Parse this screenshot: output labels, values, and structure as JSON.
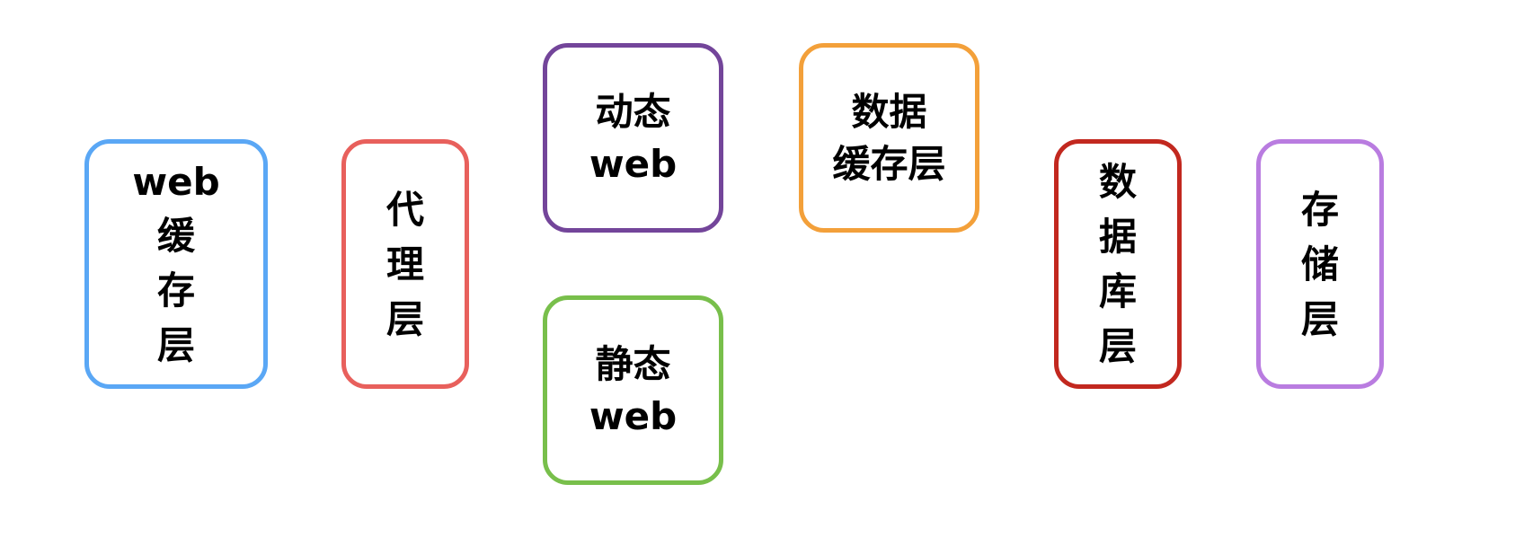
{
  "boxes": {
    "web_cache": {
      "lines": [
        "web",
        "缓",
        "存",
        "层"
      ],
      "color": "#5aa7f5"
    },
    "proxy": {
      "lines": [
        "代",
        "理",
        "层"
      ],
      "color": "#e8605c"
    },
    "dynamic_web": {
      "lines": [
        "动态",
        "web"
      ],
      "color": "#73459a"
    },
    "static_web": {
      "lines": [
        "静态",
        "web"
      ],
      "color": "#78bf4b"
    },
    "data_cache": {
      "lines": [
        "数据",
        "缓存层"
      ],
      "color": "#f3a03a"
    },
    "database": {
      "lines": [
        "数",
        "据",
        "库",
        "层"
      ],
      "color": "#c2281f"
    },
    "storage": {
      "lines": [
        "存",
        "储",
        "层"
      ],
      "color": "#b97ce0"
    }
  }
}
